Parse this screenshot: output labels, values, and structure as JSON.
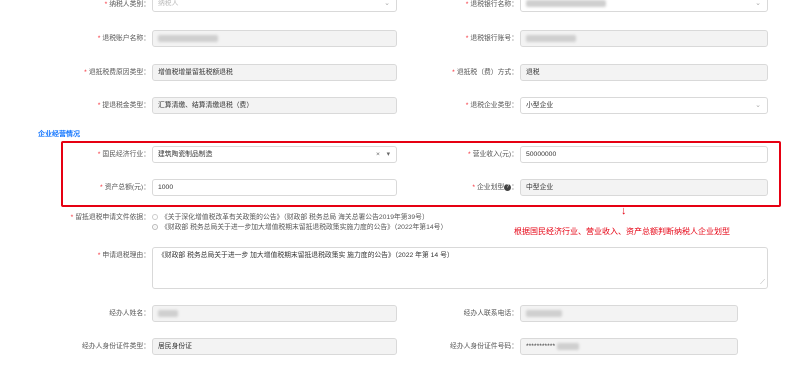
{
  "form": {
    "taxpayer_type": {
      "label": "纳税人类别：",
      "placeholder": "纳税人"
    },
    "refund_bank_name": {
      "label": "退税银行名称："
    },
    "refund_account_name": {
      "label": "退税账户名称："
    },
    "refund_bank_account": {
      "label": "退税银行账号："
    },
    "refund_reason_type": {
      "label": "退抵税费原因类型：",
      "value": "增值税增量留抵税额退税"
    },
    "refund_method": {
      "label": "退抵税（费）方式：",
      "value": "退税"
    },
    "refund_amount_type": {
      "label": "提退税金类型：",
      "value": "汇算清缴、结算清缴退税（费）"
    },
    "refund_enterprise_type": {
      "label": "退税企业类型：",
      "value": "小型企业"
    }
  },
  "section": {
    "title": "企业经营情况"
  },
  "business": {
    "industry": {
      "label": "国民经济行业：",
      "value": "建筑陶瓷制品制造",
      "clear": "×",
      "arrow": "▾"
    },
    "revenue": {
      "label": "营业收入(元)：",
      "value": "50000000"
    },
    "total_assets": {
      "label": "资产总额(元)：",
      "value": "1000"
    },
    "enterprise_size": {
      "label": "企业划型",
      "help": "?",
      "colon": "：",
      "value": "中型企业"
    }
  },
  "policy": {
    "label": "留抵退税申请文件依据：",
    "options": [
      "《关于深化增值税改革有关政策的公告》（财政部 税务总局 海关总署公告2019年第39号）",
      "《财政部 税务总局关于进一步加大增值税期末留抵退税政策实施力度的公告》（2022年第14号）"
    ],
    "selected_index": 1
  },
  "annotation": {
    "text": "根据国民经济行业、营业收入、资产总额判断纳税人企业划型",
    "arrow": "↓"
  },
  "reason": {
    "label": "申请退税理由：",
    "value": "《财政部 税务总局关于进一步 加大增值税期末留抵退税政策实 施力度的公告》（2022 年第 14 号）"
  },
  "agent": {
    "name_label": "经办人姓名：",
    "phone_label": "经办人联系电话：",
    "id_type_label": "经办人身份证件类型：",
    "id_type_value": "居民身份证",
    "id_no_label": "经办人身份证件号码：",
    "id_no_value": "***********"
  },
  "colors": {
    "accent": "#1677ff",
    "required": "#f5222d",
    "highlight": "#e60012"
  }
}
